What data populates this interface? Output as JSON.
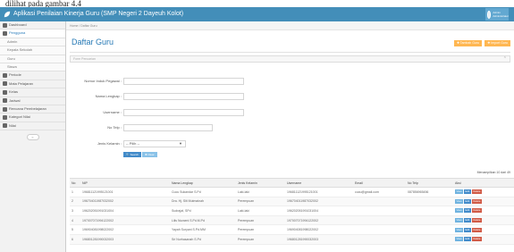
{
  "caption": "dilihat pada gambar 4.4",
  "app": {
    "title": "Aplikasi Penilaian Kinerja Guru (SMP Negeri 2 Dayeuh Kolot)",
    "user": {
      "name": "Admin Administrator"
    }
  },
  "sidebar": {
    "items": [
      {
        "label": "Dashboard",
        "icon": "dashboard-icon",
        "active": false,
        "sub": false
      },
      {
        "label": "Pengguna",
        "icon": "users-icon",
        "active": true,
        "sub": false
      },
      {
        "label": "Admin",
        "icon": "",
        "active": false,
        "sub": true
      },
      {
        "label": "Kepala Sekolah",
        "icon": "",
        "active": false,
        "sub": true
      },
      {
        "label": "Guru",
        "icon": "",
        "active": false,
        "sub": true
      },
      {
        "label": "Siswa",
        "icon": "",
        "active": false,
        "sub": true
      },
      {
        "label": "Periode",
        "icon": "calendar-icon",
        "active": false,
        "sub": false
      },
      {
        "label": "Mata Pelajaran",
        "icon": "book-icon",
        "active": false,
        "sub": false
      },
      {
        "label": "Kelas",
        "icon": "class-icon",
        "active": false,
        "sub": false
      },
      {
        "label": "Jadwal",
        "icon": "schedule-icon",
        "active": false,
        "sub": false
      },
      {
        "label": "Rencana Pembelajaran",
        "icon": "plan-icon",
        "active": false,
        "sub": false
      },
      {
        "label": "Kategori Nilai",
        "icon": "category-icon",
        "active": false,
        "sub": false
      },
      {
        "label": "Nilai",
        "icon": "grade-icon",
        "active": false,
        "sub": false
      }
    ]
  },
  "breadcrumb": "Home / Daftar Guru",
  "page": {
    "title": "Daftar Guru",
    "btn_add": "Tambah Guru",
    "btn_import": "Import Guru",
    "filter_title": "Form Pencarian"
  },
  "form": {
    "nip_label": "Nomor Induk Pegawai :",
    "name_label": "Nama Lengkap :",
    "username_label": "Username :",
    "phone_label": "No Telp :",
    "gender_label": "Jenis Kelamin :",
    "gender_selected": "-- Pilih --",
    "search_label": "Search",
    "clear_label": "Clear"
  },
  "pageinfo": "Menampilkan 10 dari 49",
  "table": {
    "columns": [
      "No",
      "NIP",
      "Nama Lengkap",
      "Jenis Kelamin",
      "Username",
      "Email",
      "No Telp",
      "Aksi"
    ],
    "rows": [
      [
        "1",
        "196811121995121001",
        "Cucu Sukandar S.Pd",
        "Laki-laki",
        "196811121995121001",
        "cucu@gmail.com",
        "087856965456"
      ],
      [
        "2",
        "196704011987032002",
        "Dra. Hj. Siti Mutmainah",
        "Perempuan",
        "196704011987032002",
        "",
        ""
      ],
      [
        "3",
        "196202051991031004",
        "Sudrajat, SPd",
        "Laki-laki",
        "196202051991031004",
        "",
        ""
      ],
      [
        "4",
        "197007071994122002",
        "Lilis Nuraeni S.Pd.M.Pd",
        "Perempuan",
        "197007071994122002",
        "",
        ""
      ],
      [
        "5",
        "196904081998022002",
        "Yayah Suryani S.Pd.MM",
        "Perempuan",
        "196904081998022002",
        "",
        ""
      ],
      [
        "6",
        "196801281990032003",
        "Sri Nurhasanah S.Pd",
        "Perempuan",
        "196801281990032003",
        "",
        ""
      ]
    ],
    "actions": {
      "view": "View",
      "edit": "Edit",
      "delete": "Delete"
    }
  },
  "colors": {
    "topbar": "#438eb9",
    "accent": "#2679b5",
    "warning": "#ffb752",
    "danger": "#d15b47"
  }
}
